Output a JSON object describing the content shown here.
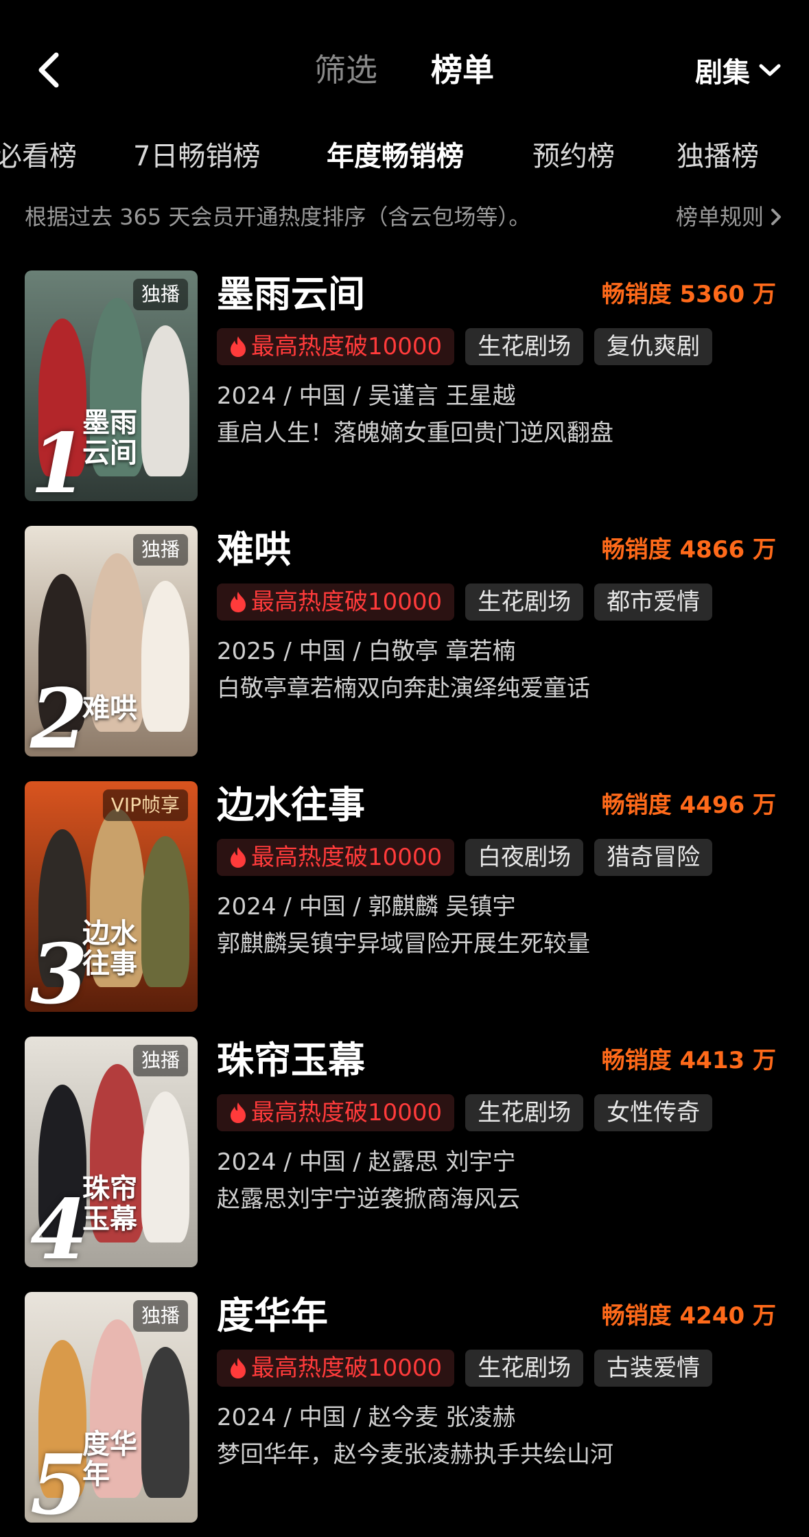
{
  "header": {
    "tabs": [
      {
        "label": "筛选"
      },
      {
        "label": "榜单"
      }
    ],
    "category": "剧集"
  },
  "subtabs": [
    {
      "label": "必看榜"
    },
    {
      "label": "7日畅销榜"
    },
    {
      "label": "年度畅销榜"
    },
    {
      "label": "预约榜"
    },
    {
      "label": "独播榜"
    }
  ],
  "description": "根据过去 365 天会员开通热度排序（含云包场等）。",
  "rules_label": "榜单规则",
  "items": [
    {
      "rank": "1",
      "title": "墨雨云间",
      "poster_title": "墨雨云间",
      "badge": "独播",
      "sales": "畅销度 5360 万",
      "hot_tag": "最高热度破10000",
      "tags": [
        "生花剧场",
        "复仇爽剧"
      ],
      "meta": "2024 / 中国 / 吴谨言 王星越",
      "slogan": "重启人生！落魄嫡女重回贵门逆风翻盘",
      "colors": {
        "bg1": "#6a8076",
        "bg2": "#2f3a36",
        "fig1": "#b3262a",
        "fig2": "#5a7d6d",
        "fig3": "#e3e0da"
      }
    },
    {
      "rank": "2",
      "title": "难哄",
      "poster_title": "难哄",
      "badge": "独播",
      "sales": "畅销度 4866 万",
      "hot_tag": "最高热度破10000",
      "tags": [
        "生花剧场",
        "都市爱情"
      ],
      "meta": "2025 / 中国 / 白敬亭 章若楠",
      "slogan": "白敬亭章若楠双向奔赴演绎纯爱童话",
      "colors": {
        "bg1": "#e9e2d6",
        "bg2": "#8d7a68",
        "fig1": "#2a2320",
        "fig2": "#d9bfa8",
        "fig3": "#f3ede4"
      }
    },
    {
      "rank": "3",
      "title": "边水往事",
      "poster_title": "边水往事",
      "badge": "VIP帧享",
      "sales": "畅销度 4496 万",
      "hot_tag": "最高热度破10000",
      "tags": [
        "白夜剧场",
        "猎奇冒险"
      ],
      "meta": "2024 / 中国 / 郭麒麟 吴镇宇",
      "slogan": "郭麒麟吴镇宇异域冒险开展生死较量",
      "colors": {
        "bg1": "#d9541f",
        "bg2": "#5a1f0a",
        "fig1": "#2f2a26",
        "fig2": "#c9a16a",
        "fig3": "#6b6a3a"
      }
    },
    {
      "rank": "4",
      "title": "珠帘玉幕",
      "poster_title": "珠帘玉幕",
      "badge": "独播",
      "sales": "畅销度 4413 万",
      "hot_tag": "最高热度破10000",
      "tags": [
        "生花剧场",
        "女性传奇"
      ],
      "meta": "2024 / 中国 / 赵露思 刘宇宁",
      "slogan": "赵露思刘宇宁逆袭掀商海风云",
      "colors": {
        "bg1": "#e6e2da",
        "bg2": "#a7a39b",
        "fig1": "#1e1e22",
        "fig2": "#b33d3d",
        "fig3": "#f0ece6"
      }
    },
    {
      "rank": "5",
      "title": "度华年",
      "poster_title": "度华年",
      "badge": "独播",
      "sales": "畅销度 4240 万",
      "hot_tag": "最高热度破10000",
      "tags": [
        "生花剧场",
        "古装爱情"
      ],
      "meta": "2024 / 中国 / 赵今麦 张凌赫",
      "slogan": "梦回华年，赵今麦张凌赫执手共绘山河",
      "colors": {
        "bg1": "#e9e4dc",
        "bg2": "#b8b0a2",
        "fig1": "#d99a4a",
        "fig2": "#e8b7b0",
        "fig3": "#3a3a3a"
      }
    }
  ]
}
